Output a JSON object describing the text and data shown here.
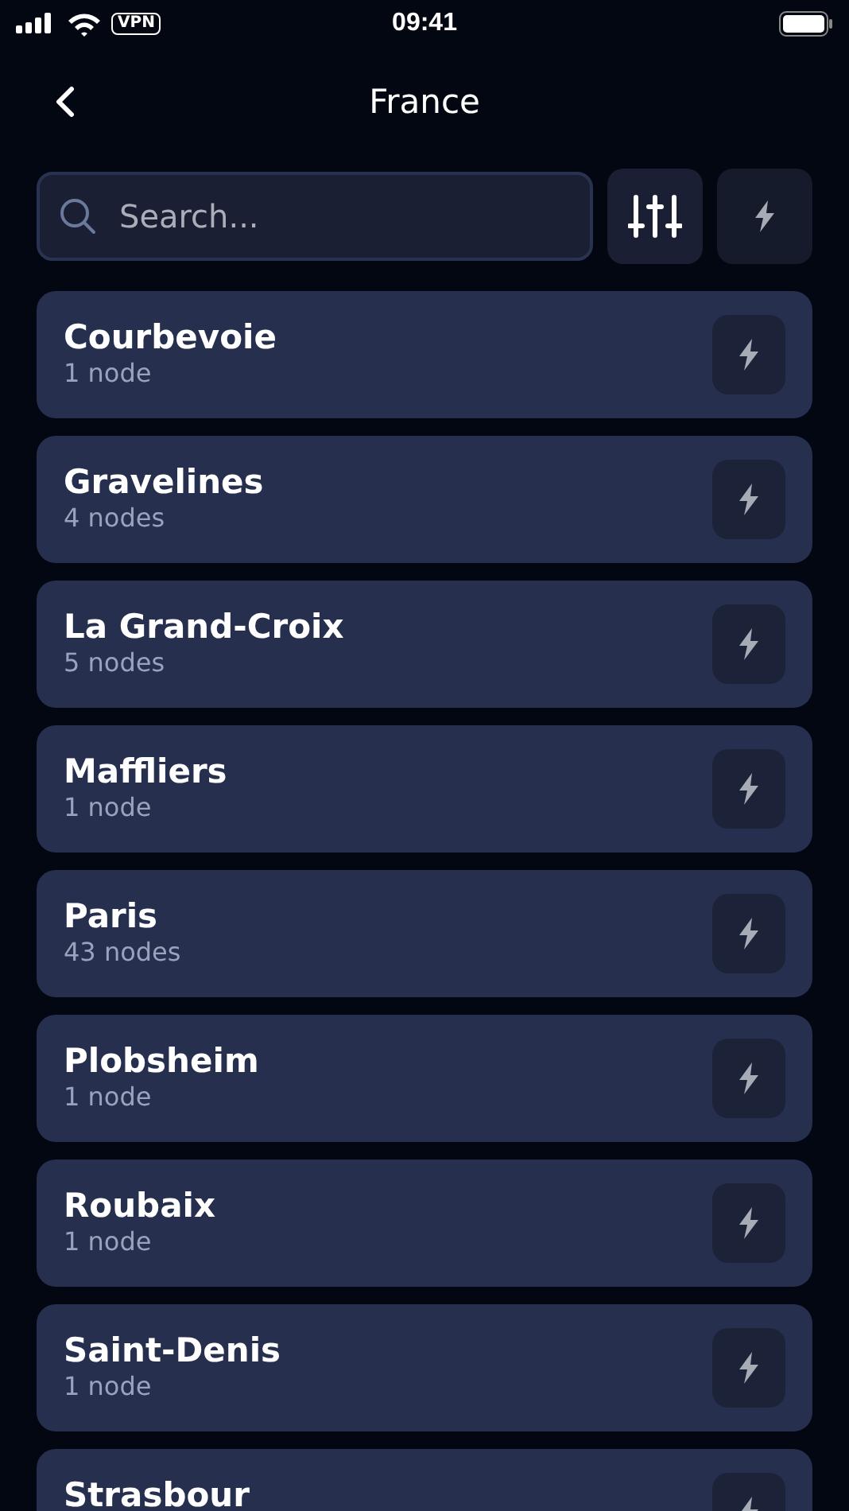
{
  "status_bar": {
    "time": "09:41",
    "vpn": "VPN"
  },
  "header": {
    "title": "France"
  },
  "search": {
    "placeholder": "Search..."
  },
  "locations": [
    {
      "name": "Courbevoie",
      "nodes": "1 node"
    },
    {
      "name": "Gravelines",
      "nodes": "4 nodes"
    },
    {
      "name": "La Grand-Croix",
      "nodes": "5 nodes"
    },
    {
      "name": "Maffliers",
      "nodes": "1 node"
    },
    {
      "name": "Paris",
      "nodes": "43 nodes"
    },
    {
      "name": "Plobsheim",
      "nodes": "1 node"
    },
    {
      "name": "Roubaix",
      "nodes": "1 node"
    },
    {
      "name": "Saint-Denis",
      "nodes": "1 node"
    },
    {
      "name": "Strasbour"
    }
  ]
}
